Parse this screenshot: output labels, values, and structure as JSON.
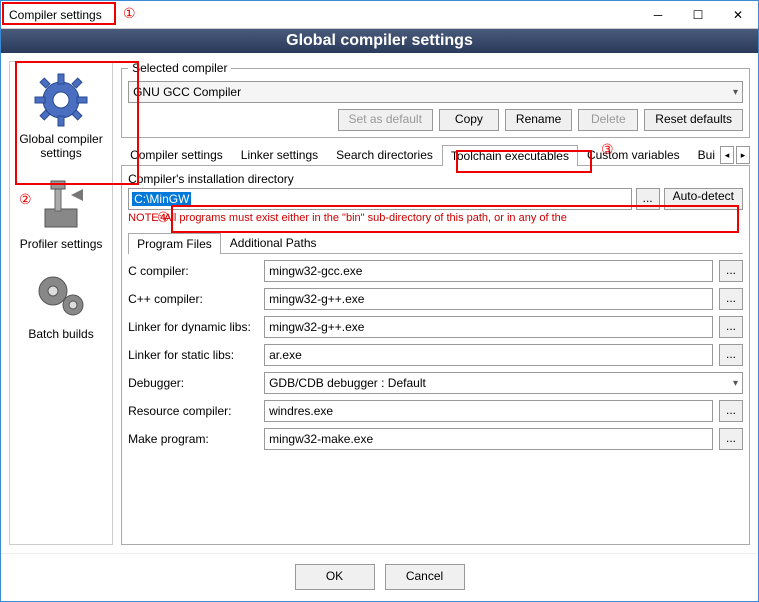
{
  "window": {
    "title": "Compiler settings"
  },
  "banner": "Global compiler settings",
  "sidebar": {
    "items": [
      {
        "label": "Global compiler settings"
      },
      {
        "label": "Profiler settings"
      },
      {
        "label": "Batch builds"
      }
    ]
  },
  "selected_compiler": {
    "legend": "Selected compiler",
    "value": "GNU GCC Compiler",
    "buttons": {
      "set_default": "Set as default",
      "copy": "Copy",
      "rename": "Rename",
      "delete": "Delete",
      "reset": "Reset defaults"
    }
  },
  "tabs": {
    "items": [
      "Compiler settings",
      "Linker settings",
      "Search directories",
      "Toolchain executables",
      "Custom variables",
      "Bui"
    ],
    "active_index": 3
  },
  "install_dir": {
    "legend": "Compiler's installation directory",
    "path": "C:\\MinGW",
    "browse": "...",
    "auto": "Auto-detect",
    "note": "NOTE: All programs must exist either in the \"bin\" sub-directory of this path, or in any of the"
  },
  "subtabs": {
    "items": [
      "Program Files",
      "Additional Paths"
    ],
    "active_index": 0
  },
  "programs": [
    {
      "label": "C compiler:",
      "value": "mingw32-gcc.exe",
      "type": "text"
    },
    {
      "label": "C++ compiler:",
      "value": "mingw32-g++.exe",
      "type": "text"
    },
    {
      "label": "Linker for dynamic libs:",
      "value": "mingw32-g++.exe",
      "type": "text"
    },
    {
      "label": "Linker for static libs:",
      "value": "ar.exe",
      "type": "text"
    },
    {
      "label": "Debugger:",
      "value": "GDB/CDB debugger : Default",
      "type": "combo"
    },
    {
      "label": "Resource compiler:",
      "value": "windres.exe",
      "type": "text"
    },
    {
      "label": "Make program:",
      "value": "mingw32-make.exe",
      "type": "text"
    }
  ],
  "dialog_buttons": {
    "ok": "OK",
    "cancel": "Cancel"
  },
  "annotations": [
    "①",
    "②",
    "③",
    "④"
  ]
}
